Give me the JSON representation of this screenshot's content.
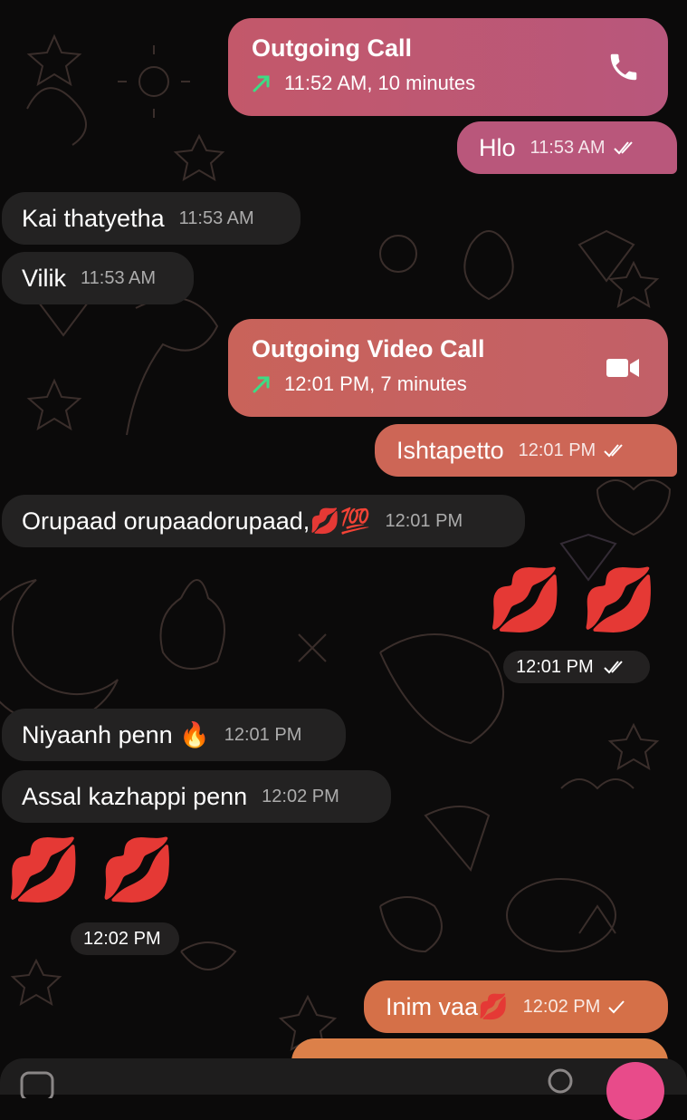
{
  "colors": {
    "background": "#0b0a0a",
    "incoming_bubble": "#232222",
    "outgoing_call_gradient": [
      "#c3586a",
      "#b8577c"
    ],
    "outgoing_video_gradient": [
      "#c9635a",
      "#c26068"
    ],
    "outgoing_orange": "#d57048",
    "outgoing_orange_light": "#dc8049",
    "call_arrow_green": "#3ddc84"
  },
  "messages": {
    "call1": {
      "title": "Outgoing Call",
      "meta": "11:52 AM, 10 minutes",
      "icon": "phone-icon"
    },
    "hlo": {
      "text": "Hlo",
      "time": "11:53 AM"
    },
    "kai": {
      "text": "Kai thatyetha",
      "time": "11:53 AM"
    },
    "vilik": {
      "text": "Vilik",
      "time": "11:53 AM"
    },
    "call2": {
      "title": "Outgoing Video Call",
      "meta": "12:01 PM, 7 minutes",
      "icon": "video-camera-icon"
    },
    "ishtapetto": {
      "text": "Ishtapetto",
      "time": "12:01 PM"
    },
    "orupaad": {
      "text": "Orupaad orupaadorupaad,💋💯",
      "time": "12:01 PM"
    },
    "kiss_out": {
      "emoji": "💋 💋",
      "time": "12:01 PM"
    },
    "niyaanh": {
      "text": "Niyaanh penn 🔥",
      "time": "12:01 PM"
    },
    "assal": {
      "text": "Assal kazhappi penn",
      "time": "12:02 PM"
    },
    "kiss_in": {
      "emoji": "💋 💋",
      "time": "12:02 PM"
    },
    "inim": {
      "text": "Inim vaa💋",
      "time": "12:02 PM"
    }
  }
}
